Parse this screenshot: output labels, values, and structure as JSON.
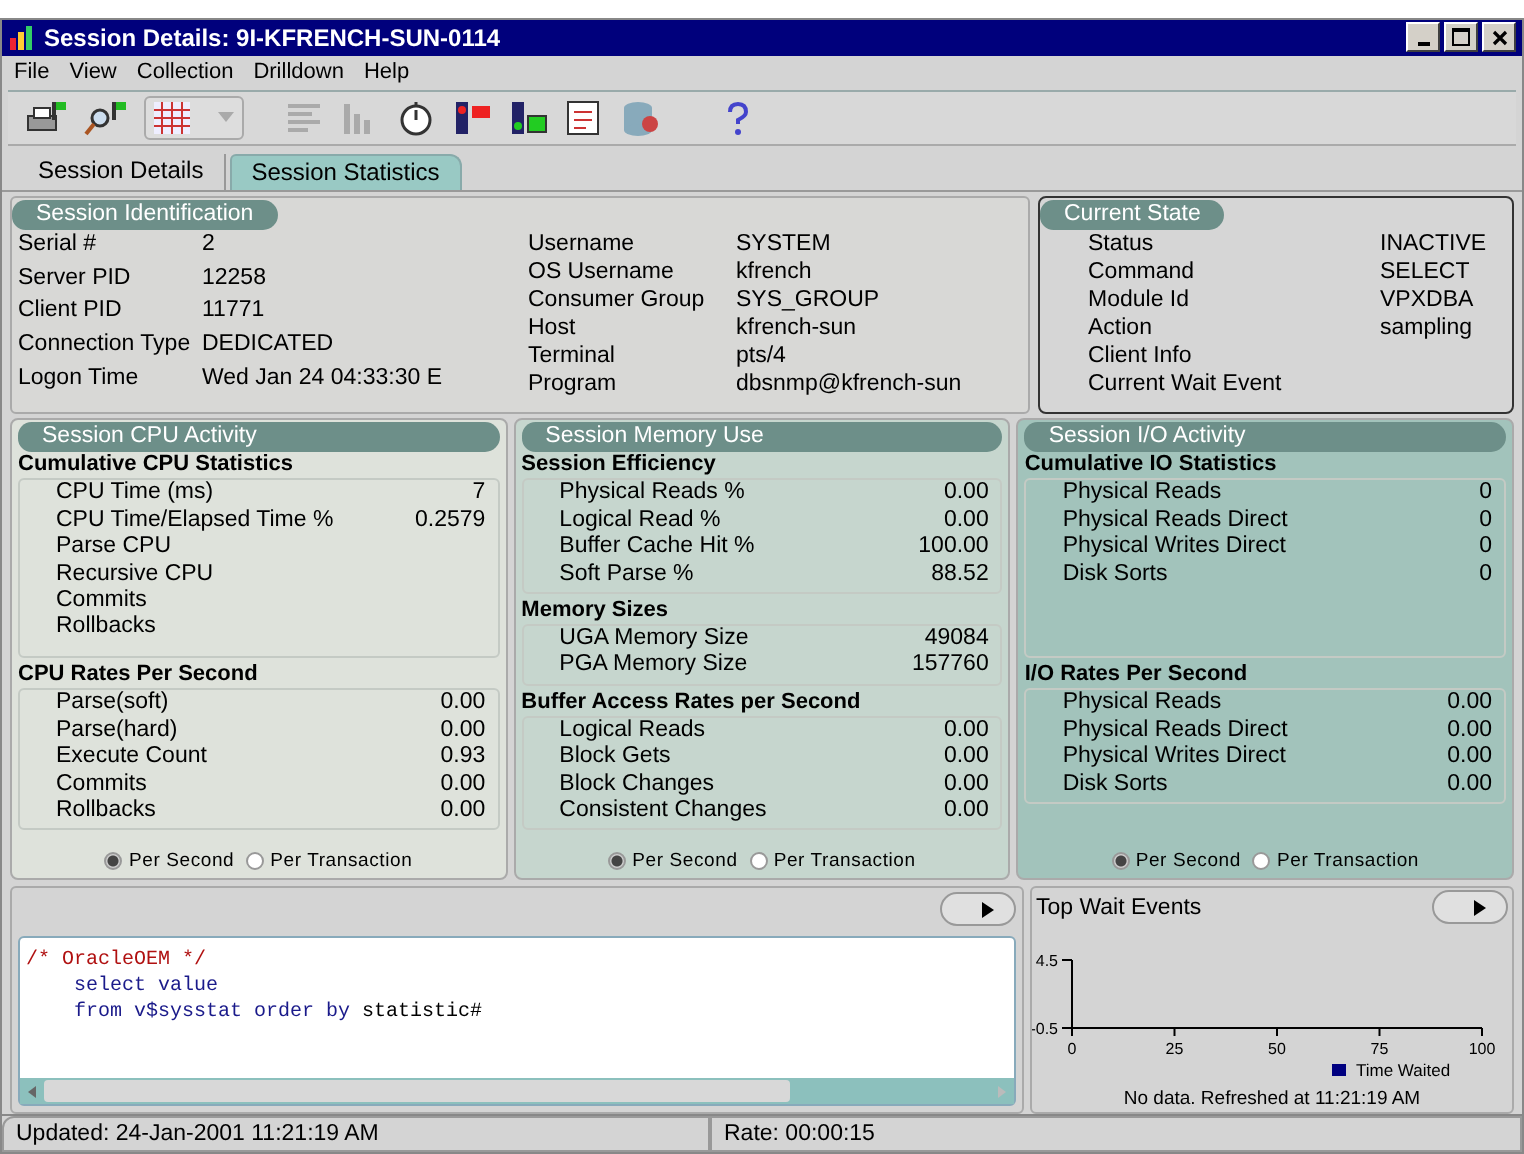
{
  "window": {
    "title": "Session Details: 9I-KFRENCH-SUN-0114"
  },
  "menu": [
    "File",
    "View",
    "Collection",
    "Drilldown",
    "Help"
  ],
  "tabs": [
    {
      "label": "Session Details",
      "selected": false
    },
    {
      "label": "Session Statistics",
      "selected": true
    }
  ],
  "session_identification": {
    "title": "Session Identification",
    "left": [
      {
        "label": "Serial #",
        "value": "2"
      },
      {
        "label": "Server PID",
        "value": "12258"
      },
      {
        "label": "Client PID",
        "value": "11771"
      },
      {
        "label": "Connection Type",
        "value": "DEDICATED"
      },
      {
        "label": "Logon Time",
        "value": "Wed Jan 24 04:33:30 E"
      }
    ],
    "right": [
      {
        "label": "Username",
        "value": "SYSTEM"
      },
      {
        "label": "OS Username",
        "value": "kfrench"
      },
      {
        "label": "Consumer Group",
        "value": "SYS_GROUP"
      },
      {
        "label": "Host",
        "value": "kfrench-sun"
      },
      {
        "label": "Terminal",
        "value": "pts/4"
      },
      {
        "label": "Program",
        "value": "dbsnmp@kfrench-sun"
      }
    ]
  },
  "current_state": {
    "title": "Current State",
    "fields": [
      {
        "label": "Status",
        "value": "INACTIVE"
      },
      {
        "label": "Command",
        "value": "SELECT"
      },
      {
        "label": "Module Id",
        "value": "VPXDBA"
      },
      {
        "label": "Action",
        "value": "sampling"
      },
      {
        "label": "Client Info"
      },
      {
        "label": "Current Wait Event"
      }
    ]
  },
  "panels": [
    {
      "title": "Session CPU Activity",
      "sections": [
        {
          "heading": "Cumulative CPU Statistics",
          "rows": [
            {
              "label": "CPU Time (ms)",
              "value": "7"
            },
            {
              "label": "CPU Time/Elapsed Time %",
              "value": "0.2579"
            },
            {
              "label": "Parse CPU"
            },
            {
              "label": "Recursive CPU"
            },
            {
              "label": "Commits"
            },
            {
              "label": "Rollbacks"
            }
          ]
        },
        {
          "heading": "CPU Rates Per Second",
          "rows": [
            {
              "label": "Parse(soft)",
              "value": "0.00"
            },
            {
              "label": "Parse(hard)",
              "value": "0.00"
            },
            {
              "label": "Execute Count",
              "value": "0.93"
            },
            {
              "label": "Commits",
              "value": "0.00"
            },
            {
              "label": "Rollbacks",
              "value": "0.00"
            }
          ]
        }
      ],
      "options": [
        {
          "label": "Per Second",
          "selected": true
        },
        {
          "label": "Per Transaction",
          "selected": false
        }
      ]
    },
    {
      "title": "Session Memory Use",
      "sections": [
        {
          "heading": "Session Efficiency",
          "rows": [
            {
              "label": "Physical Reads %",
              "value": "0.00"
            },
            {
              "label": "Logical Read %",
              "value": "0.00"
            },
            {
              "label": "Buffer Cache Hit %",
              "value": "100.00"
            },
            {
              "label": "Soft Parse %",
              "value": "88.52"
            }
          ]
        },
        {
          "heading": "Memory Sizes",
          "rows": [
            {
              "label": "UGA Memory Size",
              "value": "49084"
            },
            {
              "label": "PGA Memory Size",
              "value": "157760"
            }
          ]
        },
        {
          "heading": "Buffer Access Rates per Second",
          "rows": [
            {
              "label": "Logical Reads",
              "value": "0.00"
            },
            {
              "label": "Block Gets",
              "value": "0.00"
            },
            {
              "label": "Block Changes",
              "value": "0.00"
            },
            {
              "label": "Consistent Changes",
              "value": "0.00"
            }
          ]
        }
      ],
      "options": [
        {
          "label": "Per Second",
          "selected": true
        },
        {
          "label": "Per Transaction",
          "selected": false
        }
      ]
    },
    {
      "title": "Session I/O Activity",
      "sections": [
        {
          "heading": "Cumulative IO Statistics",
          "rows": [
            {
              "label": "Physical Reads",
              "value": "0"
            },
            {
              "label": "Physical Reads Direct",
              "value": "0"
            },
            {
              "label": "Physical Writes Direct",
              "value": "0"
            },
            {
              "label": "Disk Sorts",
              "value": "0"
            }
          ]
        },
        {
          "heading": "I/O Rates Per Second",
          "rows": [
            {
              "label": "Physical Reads",
              "value": "0.00"
            },
            {
              "label": "Physical Reads Direct",
              "value": "0.00"
            },
            {
              "label": "Physical Writes Direct",
              "value": "0.00"
            },
            {
              "label": "Disk Sorts",
              "value": "0.00"
            }
          ]
        }
      ],
      "options": [
        {
          "label": "Per Second",
          "selected": true
        },
        {
          "label": "Per Transaction",
          "selected": false
        }
      ]
    }
  ],
  "sql": {
    "lines": [
      [
        {
          "text": "/* OracleOEM */",
          "kind": "comment"
        }
      ],
      [
        {
          "text": "    select value",
          "kind": "keyword"
        }
      ],
      [
        {
          "text": "    from v$sysstat order by",
          "kind": "keyword"
        },
        {
          "text": " statistic#",
          "kind": "plain"
        }
      ]
    ]
  },
  "wait_events": {
    "title": "Top Wait Events",
    "note": "No data. Refreshed at 11:21:19 AM",
    "chart_data": {
      "type": "line",
      "categories": [
        "0",
        "25",
        "50",
        "75",
        "100"
      ],
      "ylim": [
        -0.5,
        4.5
      ],
      "yticks": [
        -0.5,
        4.5
      ],
      "series": [
        {
          "name": "Time Waited",
          "color": "#000080",
          "values": [
            null,
            null,
            null,
            null,
            null
          ]
        }
      ]
    }
  },
  "status_bar": [
    "Updated: 24-Jan-2001 11:21:19 AM",
    "Rate: 00:00:15"
  ]
}
